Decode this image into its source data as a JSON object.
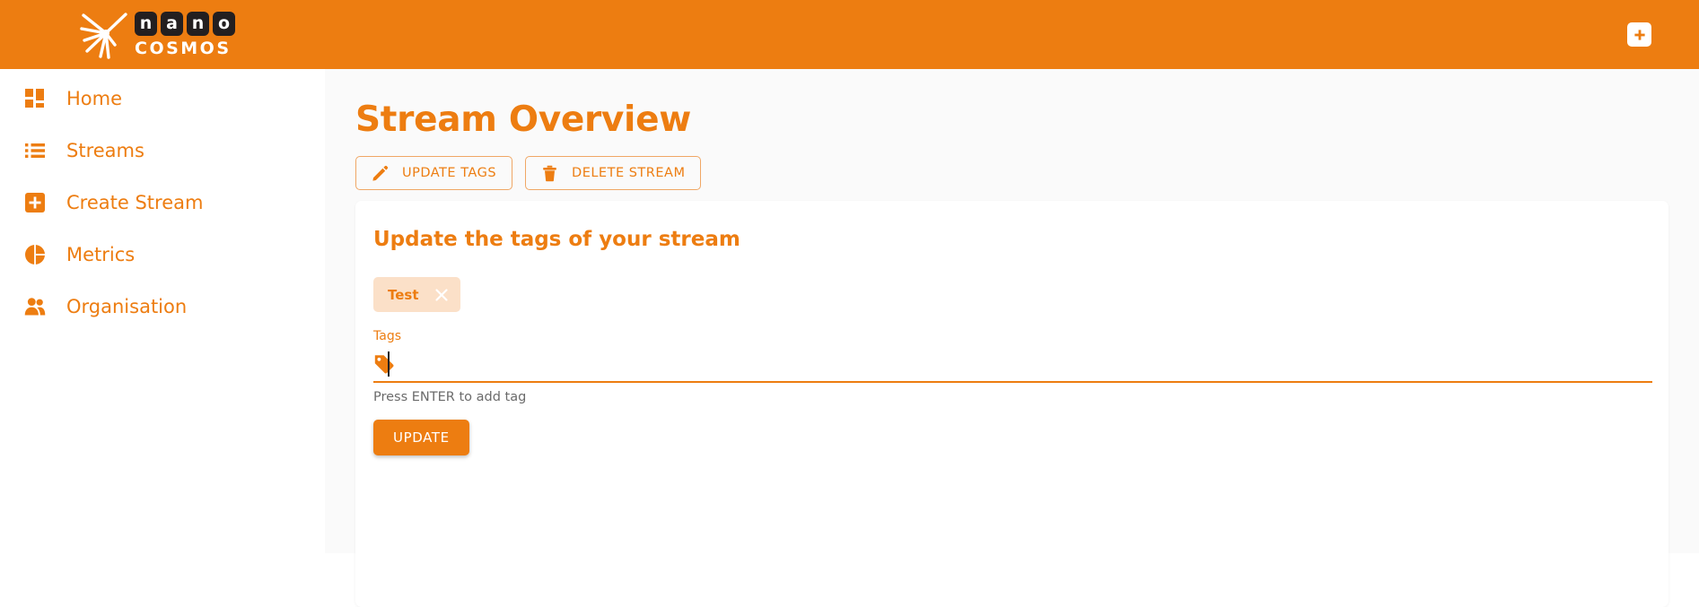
{
  "brand": {
    "name_boxes": [
      "n",
      "a",
      "n",
      "o"
    ],
    "subtitle": "COSMOS",
    "accent_color": "#ED7D11",
    "dark_color": "#231f20"
  },
  "topbar": {
    "add_button_icon": "plus-icon"
  },
  "sidebar": {
    "items": [
      {
        "label": "Home",
        "icon": "dashboard-grid-icon"
      },
      {
        "label": "Streams",
        "icon": "list-icon"
      },
      {
        "label": "Create Stream",
        "icon": "plus-square-icon"
      },
      {
        "label": "Metrics",
        "icon": "pie-chart-icon"
      },
      {
        "label": "Organisation",
        "icon": "people-icon"
      }
    ]
  },
  "main": {
    "page_title": "Stream Overview",
    "actions": [
      {
        "label": "UPDATE TAGS",
        "icon": "pencil-icon"
      },
      {
        "label": "DELETE STREAM",
        "icon": "trash-icon"
      }
    ],
    "card": {
      "title": "Update the tags of your stream",
      "tags": [
        {
          "label": "Test",
          "remove_icon": "close-x-icon"
        }
      ],
      "field": {
        "label": "Tags",
        "icon": "tag-icon",
        "value": "",
        "placeholder": "",
        "hint": "Press ENTER to add tag"
      },
      "submit_label": "UPDATE"
    }
  }
}
